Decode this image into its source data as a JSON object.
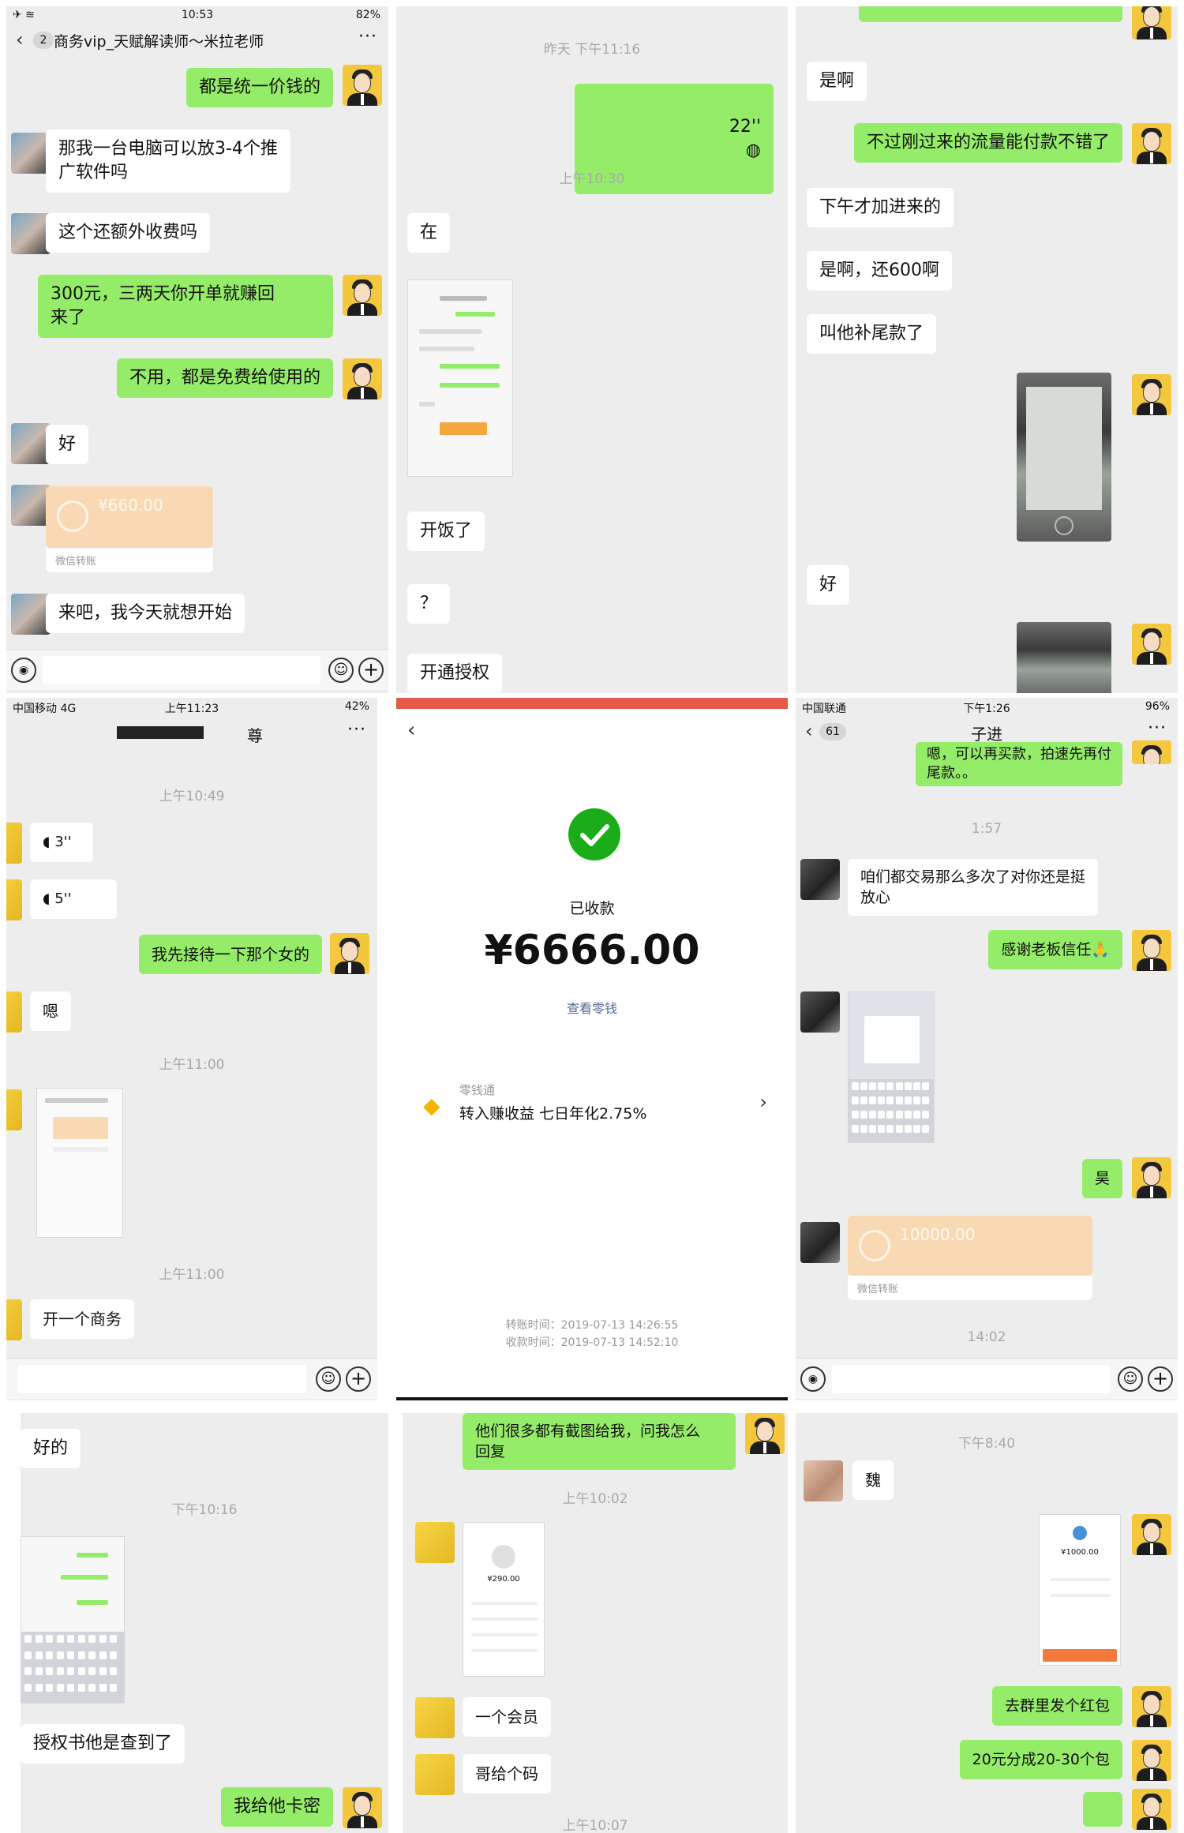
{
  "p1": {
    "status": {
      "time": "10:53",
      "battery": "82%"
    },
    "nav": {
      "back_count": "2",
      "title": "商务vip_天赋解读师～米拉老师",
      "more": "···"
    },
    "msgs": [
      {
        "side": "me",
        "text": "都是统一价钱的"
      },
      {
        "side": "other",
        "text": "那我一台电脑可以放3-4个推\n广软件吗"
      },
      {
        "side": "other",
        "text": "这个还额外收费吗"
      },
      {
        "side": "me",
        "text": "300元，三两天你开单就赚回\n来了"
      },
      {
        "side": "me",
        "text": "不用，都是免费给使用的"
      },
      {
        "side": "other",
        "text": "好"
      },
      {
        "side": "other",
        "text": "来吧，我今天就想开始"
      }
    ],
    "transfer": {
      "amount": "¥660.00",
      "footer": "微信转账"
    }
  },
  "p2": {
    "times": [
      "昨天 下午11:16",
      "上午10:30"
    ],
    "voice": "22''",
    "msgs": [
      "在",
      "开饭了",
      "？",
      "开通授权"
    ]
  },
  "p3": {
    "msgs": [
      {
        "side": "other",
        "text": "是啊"
      },
      {
        "side": "me",
        "text": "不过刚过来的流量能付款不错了"
      },
      {
        "side": "other",
        "text": "下午才加进来的"
      },
      {
        "side": "other",
        "text": "是啊，还600啊"
      },
      {
        "side": "other",
        "text": "叫他补尾款了"
      },
      {
        "side": "other",
        "text": "好"
      }
    ]
  },
  "p4": {
    "status": {
      "left": "中国移动 4G",
      "time": "上午11:23",
      "battery": "42%"
    },
    "nav": {
      "title": "尊",
      "more": "···"
    },
    "times": [
      "上午10:49",
      "上午11:00",
      "上午11:00"
    ],
    "voices": [
      "3''",
      "5''"
    ],
    "msgs": [
      {
        "side": "me",
        "text": "我先接待一下那个女的"
      },
      {
        "side": "other",
        "text": "嗯"
      },
      {
        "side": "other",
        "text": "开一个商务"
      }
    ]
  },
  "p5": {
    "status_label": "已收款",
    "amount": "¥6666.00",
    "link": "查看零钱",
    "lct_title": "零钱通",
    "lct_desc": "转入赚收益 七日年化2.75%",
    "transfer_time": "转账时间：2019-07-13 14:26:55",
    "receive_time": "收款时间：2019-07-13 14:52:10"
  },
  "p6": {
    "status": {
      "left": "中国联通",
      "time": "下午1:26",
      "battery": "96%"
    },
    "nav": {
      "back_count": "61",
      "title": "子进",
      "more": "···"
    },
    "top_msg": "嗯，可以再买款，拍速先再付\n尾款。。",
    "times": [
      "1:57",
      "14:02"
    ],
    "msgs": [
      {
        "side": "other",
        "text": "咱们都交易那么多次了对你还是挺\n放心"
      },
      {
        "side": "me",
        "text": "感谢老板信任🙏"
      },
      {
        "side": "me",
        "text": "昊"
      }
    ],
    "transfer": {
      "amount": "10000.00",
      "footer": "微信转账"
    }
  },
  "p7": {
    "times": [
      "下午10:16"
    ],
    "msgs": [
      {
        "side": "other",
        "text": "好的"
      },
      {
        "side": "other",
        "text": "授权书他是查到了"
      },
      {
        "side": "me",
        "text": "我给他卡密"
      }
    ]
  },
  "p8": {
    "times": [
      "上午10:02",
      "上午10:07"
    ],
    "msgs": [
      {
        "side": "me",
        "text": "他们很多都有截图给我，问我怎么\n回复"
      },
      {
        "side": "other",
        "text": "一个会员"
      },
      {
        "side": "other",
        "text": "哥给个码"
      }
    ],
    "mini_amount": "¥290.00"
  },
  "p9": {
    "times": [
      "下午8:40"
    ],
    "msgs": [
      {
        "side": "other",
        "text": "魏"
      },
      {
        "side": "me",
        "text": "去群里发个红包"
      },
      {
        "side": "me",
        "text": "20元分成20-30个包"
      }
    ],
    "mini_amount": "¥1000.00"
  },
  "colors": {
    "bubble_green": "#95ec69",
    "chat_bg": "#ededed",
    "pay_green": "#1aad19",
    "transfer_orange": "#f9d9b4"
  },
  "icons": [
    "back-icon",
    "more-icon",
    "voice-icon",
    "emoji-icon",
    "plus-icon",
    "check-icon",
    "diamond-icon",
    "chevron-right-icon"
  ]
}
